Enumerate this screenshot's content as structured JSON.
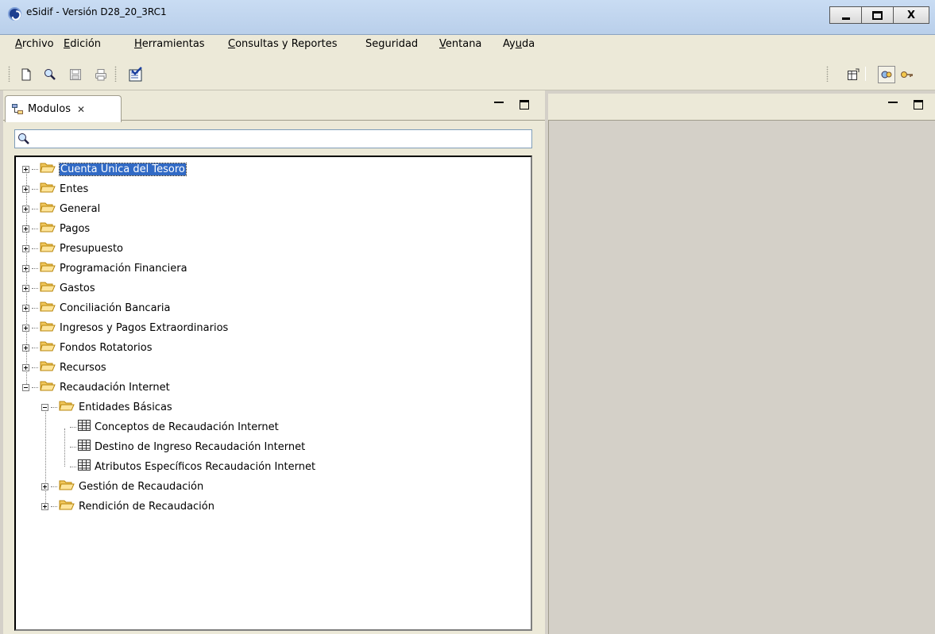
{
  "window": {
    "title": "eSidif - Versión D28_20_3RC1",
    "minimize": "minimize",
    "maximize": "maximize",
    "close": "X"
  },
  "menu": [
    {
      "label": "Archivo",
      "mnemonic": "A",
      "rest": "rchivo"
    },
    {
      "label": "Edición",
      "mnemonic": "E",
      "rest": "dición"
    },
    {
      "label": "Herramientas",
      "mnemonic": "H",
      "rest": "erramientas"
    },
    {
      "label": "Consultas y Reportes",
      "mnemonic": "C",
      "rest": "onsultas y Reportes"
    },
    {
      "label": "Seguridad"
    },
    {
      "label": "Ventana",
      "mnemonic": "V",
      "rest": "entana"
    },
    {
      "label": "Ayuda",
      "pre": "Ay",
      "mnemonic": "u",
      "rest": "da"
    }
  ],
  "toolbar": {
    "icons": [
      "new-document-icon",
      "search-icon",
      "save-icon",
      "print-icon",
      "checklist-icon",
      "open-perspective-icon",
      "perspective-modules-icon",
      "perspective-keys-icon"
    ]
  },
  "left_view": {
    "tab_label": "Modulos",
    "tab_close": "✕"
  },
  "search": {
    "value": ""
  },
  "tree": [
    {
      "label": "Cuenta Única del Tesoro",
      "level": 0,
      "expander": "plus",
      "type": "folder",
      "selected": true
    },
    {
      "label": "Entes",
      "level": 0,
      "expander": "plus",
      "type": "folder"
    },
    {
      "label": "General",
      "level": 0,
      "expander": "plus",
      "type": "folder"
    },
    {
      "label": "Pagos",
      "level": 0,
      "expander": "plus",
      "type": "folder"
    },
    {
      "label": "Presupuesto",
      "level": 0,
      "expander": "plus",
      "type": "folder"
    },
    {
      "label": "Programación Financiera",
      "level": 0,
      "expander": "plus",
      "type": "folder"
    },
    {
      "label": "Gastos",
      "level": 0,
      "expander": "plus",
      "type": "folder"
    },
    {
      "label": "Conciliación Bancaria",
      "level": 0,
      "expander": "plus",
      "type": "folder"
    },
    {
      "label": "Ingresos y Pagos Extraordinarios",
      "level": 0,
      "expander": "plus",
      "type": "folder"
    },
    {
      "label": "Fondos Rotatorios",
      "level": 0,
      "expander": "plus",
      "type": "folder"
    },
    {
      "label": "Recursos",
      "level": 0,
      "expander": "plus",
      "type": "folder"
    },
    {
      "label": "Recaudación Internet",
      "level": 0,
      "expander": "minus",
      "type": "folder"
    },
    {
      "label": "Entidades Básicas",
      "level": 1,
      "expander": "minus",
      "type": "folder"
    },
    {
      "label": "Conceptos de Recaudación Internet",
      "level": 2,
      "expander": "none",
      "type": "table"
    },
    {
      "label": "Destino de Ingreso Recaudación Internet",
      "level": 2,
      "expander": "none",
      "type": "table"
    },
    {
      "label": "Atributos Específicos Recaudación Internet",
      "level": 2,
      "expander": "none",
      "type": "table"
    },
    {
      "label": "Gestión de Recaudación",
      "level": 1,
      "expander": "plus",
      "type": "folder"
    },
    {
      "label": "Rendición de Recaudación",
      "level": 1,
      "expander": "plus",
      "type": "folder"
    }
  ]
}
